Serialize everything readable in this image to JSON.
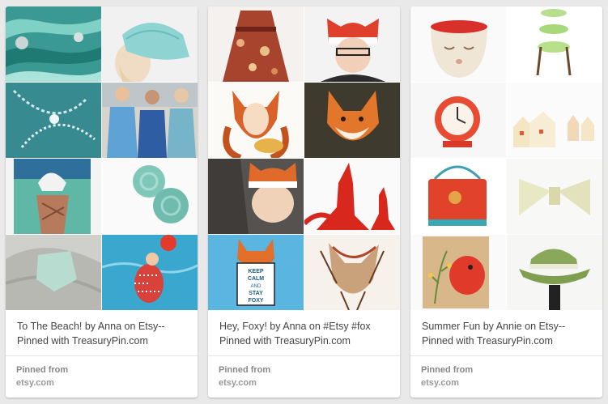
{
  "pins": [
    {
      "title": "To The Beach! by Anna on Etsy-- Pinned with TreasuryPin.com",
      "pinned_from_label": "Pinned from",
      "source": "etsy.com",
      "images": [
        "teal-yarn-skeins-image",
        "aqua-sun-hat-image",
        "shell-necklace-image",
        "women-in-dresses-image",
        "knotted-scarf-image",
        "aqua-glass-buttons-image",
        "sea-glass-image",
        "swimmer-painting-image"
      ]
    },
    {
      "title": "Hey, Foxy! by Anna on #Etsy #fox Pinned with TreasuryPin.com",
      "pinned_from_label": "Pinned from",
      "source": "etsy.com",
      "images": [
        "floral-dress-image",
        "fox-hat-woman-image",
        "fox-girl-illustration-image",
        "red-fox-photo-image",
        "baby-fox-hat-image",
        "red-fox-plush-image",
        "keep-calm-stay-foxy-poster-image",
        "fox-sketch-image"
      ]
    },
    {
      "title": "Summer Fun by Annie on Etsy-- Pinned with TreasuryPin.com",
      "pinned_from_label": "Pinned from",
      "source": "etsy.com",
      "images": [
        "face-planter-image",
        "green-stool-image",
        "red-clock-image",
        "ceramic-houses-image",
        "red-bag-image",
        "linen-bow-image",
        "red-bird-painting-image",
        "green-hat-image"
      ]
    }
  ],
  "poster_text": [
    "KEEP",
    "CALM",
    "AND",
    "STAY",
    "FOXY"
  ],
  "colors": {
    "background": "#e9e9e9",
    "card": "#ffffff",
    "text": "#444444",
    "muted": "#999999"
  }
}
